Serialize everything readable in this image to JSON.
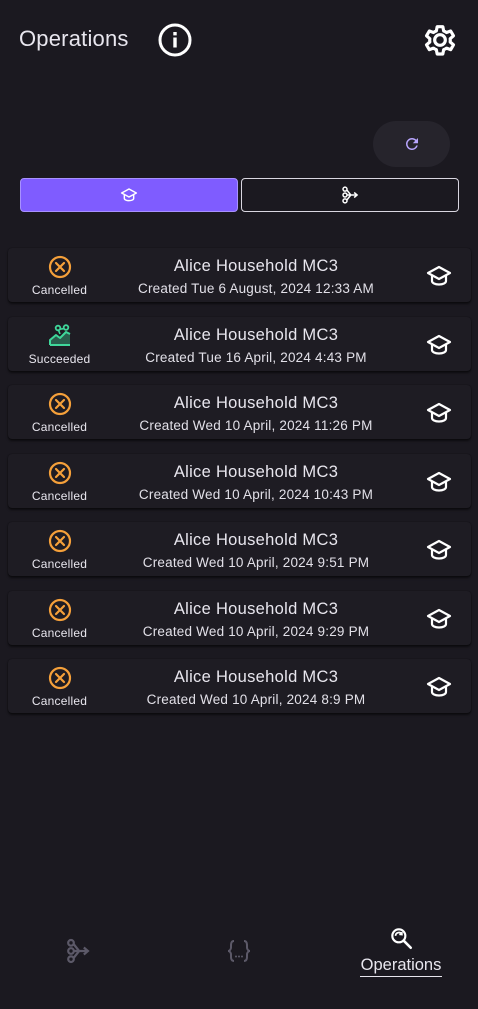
{
  "header": {
    "title": "Operations",
    "info_icon": "info-icon",
    "settings_icon": "gear-icon"
  },
  "toolbar": {
    "refresh_icon": "refresh-icon"
  },
  "filter": {
    "options": [
      {
        "icon": "graduation-cap-icon",
        "selected": true
      },
      {
        "icon": "flow-arrow-icon",
        "selected": false
      }
    ],
    "selected_color": "#7f5cff"
  },
  "operations": [
    {
      "status": "Cancelled",
      "title": "Alice Household MC3",
      "created": "Created Tue 6 August, 2024 12:33 AM",
      "type_icon": "graduation-cap-icon"
    },
    {
      "status": "Succeeded",
      "title": "Alice Household MC3",
      "created": "Created Tue 16 April, 2024 4:43 PM",
      "type_icon": "graduation-cap-icon"
    },
    {
      "status": "Cancelled",
      "title": "Alice Household MC3",
      "created": "Created Wed 10 April, 2024 11:26 PM",
      "type_icon": "graduation-cap-icon"
    },
    {
      "status": "Cancelled",
      "title": "Alice Household MC3",
      "created": "Created Wed 10 April, 2024 10:43 PM",
      "type_icon": "graduation-cap-icon"
    },
    {
      "status": "Cancelled",
      "title": "Alice Household MC3",
      "created": "Created Wed 10 April, 2024 9:51 PM",
      "type_icon": "graduation-cap-icon"
    },
    {
      "status": "Cancelled",
      "title": "Alice Household MC3",
      "created": "Created Wed 10 April, 2024 9:29 PM",
      "type_icon": "graduation-cap-icon"
    },
    {
      "status": "Cancelled",
      "title": "Alice Household MC3",
      "created": "Created Wed 10 April, 2024 8:9 PM",
      "type_icon": "graduation-cap-icon"
    }
  ],
  "status_colors": {
    "Cancelled": "#f5a03a",
    "Succeeded": "#3fd79a"
  },
  "bottom_nav": {
    "items": [
      {
        "icon": "flow-arrow-icon",
        "label": "",
        "active": false
      },
      {
        "icon": "code-braces-icon",
        "label": "",
        "active": false
      },
      {
        "icon": "search-refresh-icon",
        "label": "Operations",
        "active": true
      }
    ]
  }
}
